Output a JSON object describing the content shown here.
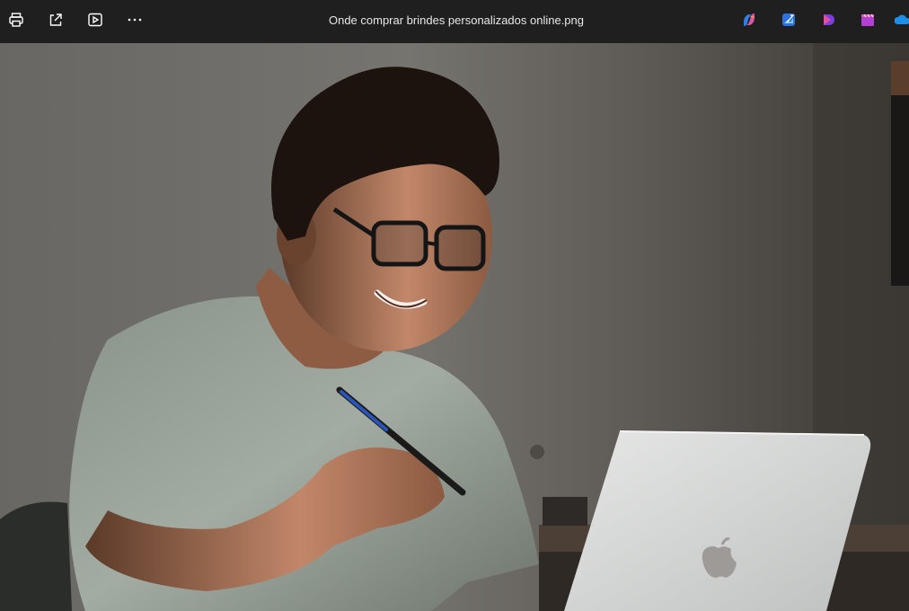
{
  "window": {
    "title": "Onde comprar brindes personalizados online.png"
  },
  "toolbar": {
    "left_actions": [
      {
        "name": "print-button",
        "icon": "printer-icon"
      },
      {
        "name": "share-button",
        "icon": "share-icon"
      },
      {
        "name": "slideshow-button",
        "icon": "play-icon"
      },
      {
        "name": "more-options-button",
        "icon": "ellipsis-icon"
      }
    ],
    "right_apps": [
      {
        "name": "copilot-button",
        "icon": "copilot-icon"
      },
      {
        "name": "photo-editor-button",
        "icon": "designer-image-icon"
      },
      {
        "name": "clipchamp-button",
        "icon": "clipchamp-icon"
      },
      {
        "name": "video-editor-button",
        "icon": "clapperboard-icon"
      },
      {
        "name": "onedrive-button",
        "icon": "cloud-icon"
      }
    ]
  },
  "image": {
    "subject": "smiling young man with glasses using a laptop"
  },
  "colors": {
    "toolbar_bg": "#1f1f1f",
    "toolbar_text": "#e8e8e8"
  }
}
